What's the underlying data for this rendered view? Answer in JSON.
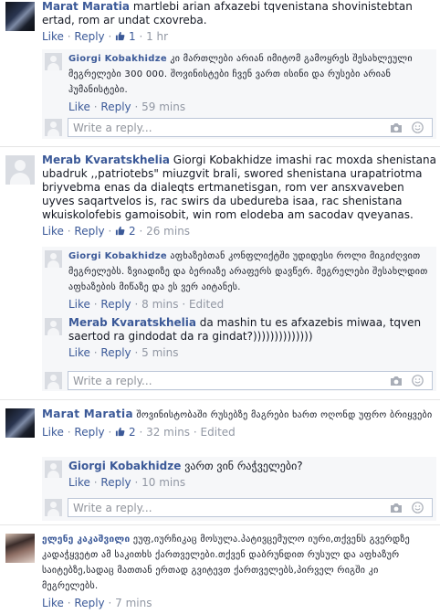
{
  "actions": {
    "like": "Like",
    "reply": "Reply",
    "sep": "·",
    "edited": "Edited",
    "write_reply": "Write a reply..."
  },
  "threads": [
    {
      "author": "Marat Maratia",
      "text": "martlebi arian afxazebi tqvenistana shovinistebtan ertad, rom ar undat cxovreba.",
      "likes": "1",
      "time": "1 hr",
      "replies": [
        {
          "author": "Giorgi Kobakhidze",
          "text": "კი მართლები არიან იმიტომ გამოყრეს შესახლეული მეგრელები 300 000. შოვინისტები ჩვენ ვართ ისინი და რუსები არიან ჰუმანისტები.",
          "time": "59 mins"
        }
      ]
    },
    {
      "author": "Merab Kvaratskhelia",
      "text": "Giorgi Kobakhidze imashi rac moxda shenistana ubadruk ,,patriotebs\" miuzgvit brali, swored shenistana urapatriotma briyvebma enas da dialeqts ertmanetisgan, rom ver ansxvaveben uyves saqartvelos is, rac swirs da ubedureba isaa, rac shenistana wkuiskolofebis gamoisobit, win rom elodeba am sacodav qveyanas.",
      "likes": "2",
      "time": "26 mins",
      "replies": [
        {
          "author": "Giorgi Kobakhidze",
          "text": "აფხაზებთან კონფლიქტში უდიდესი როლი მიგიძღვით მეგრელებს. ზვიადიზე და ბერიაზე არაფერს დავწერ. მეგრელები შესახლდით აფხაზების მიწაზე და ეს ვერ აიტანეს.",
          "time": "8 mins",
          "edited": true
        },
        {
          "author": "Merab Kvaratskhelia",
          "text": "da mashin tu es afxazebis miwaa, tqven saertod ra gindodat da ra gindat?))))))))))))))",
          "time": "5 mins"
        }
      ]
    },
    {
      "author": "Marat Maratia",
      "text": "შოვინისტობაში რუსებზე მაგრები ხართ ოღონდ უფრო ბრიყვები",
      "likes": "2",
      "time": "32 mins",
      "edited": true,
      "replies": [
        {
          "author": "Giorgi Kobakhidze",
          "text": "ვართ ვინ რაჭველები?",
          "time": "10 mins"
        }
      ]
    },
    {
      "author": "ელენე კაკაშვილი",
      "text": "ეუფ,იურჩიკაც მოსულა.პატივცემულო იური,თქვენს გვერდზე კადაჭყვეტთ ამ საკითხს ქართველები.თქვენ დაბრუნდით რუსულ და აფხაზურ საიტებზე,სადაც მათთან ერთად გვიტევთ ქართველებს,პირველ რიგში კი მეგრელებს.",
      "time": "7 mins"
    }
  ]
}
